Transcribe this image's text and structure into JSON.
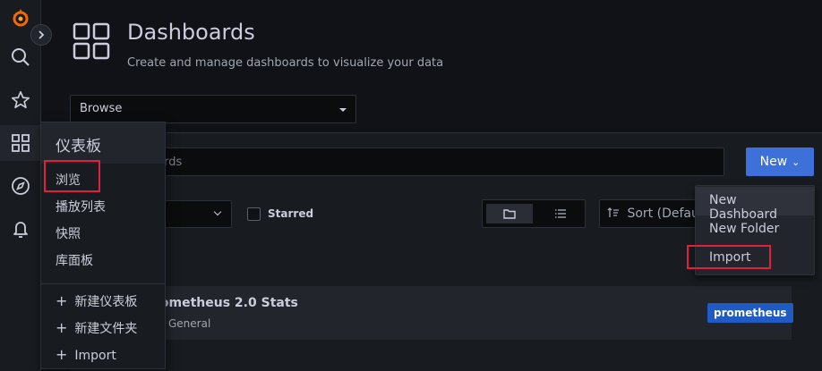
{
  "header": {
    "title": "Dashboards",
    "subtitle": "Create and manage dashboards to visualize your data"
  },
  "tab_select": {
    "value": "Browse"
  },
  "search": {
    "value": "boards"
  },
  "toolbar": {
    "new_label": "New",
    "new_chevron": "⌄"
  },
  "filters": {
    "starred_label": "Starred",
    "sort_label": "Sort (Defaul"
  },
  "list": {
    "folder_label": "l",
    "dashboard": {
      "name": "rometheus 2.0 Stats",
      "folder": "General",
      "tag": "prometheus"
    }
  },
  "new_menu": {
    "items": [
      {
        "label": "New Dashboard"
      },
      {
        "label": "New Folder"
      },
      {
        "label": "Import"
      }
    ]
  },
  "flyout": {
    "title": "仪表板",
    "items": [
      {
        "label": "浏览"
      },
      {
        "label": "播放列表"
      },
      {
        "label": "快照"
      },
      {
        "label": "库面板"
      }
    ],
    "actions": [
      {
        "label": "新建仪表板"
      },
      {
        "label": "新建文件夹"
      },
      {
        "label": "Import"
      }
    ]
  },
  "colors": {
    "background": "#111217",
    "panel": "#181b1f",
    "primary": "#3d71d9",
    "tag": "#1f5bc2",
    "highlight": "#e0203f"
  }
}
